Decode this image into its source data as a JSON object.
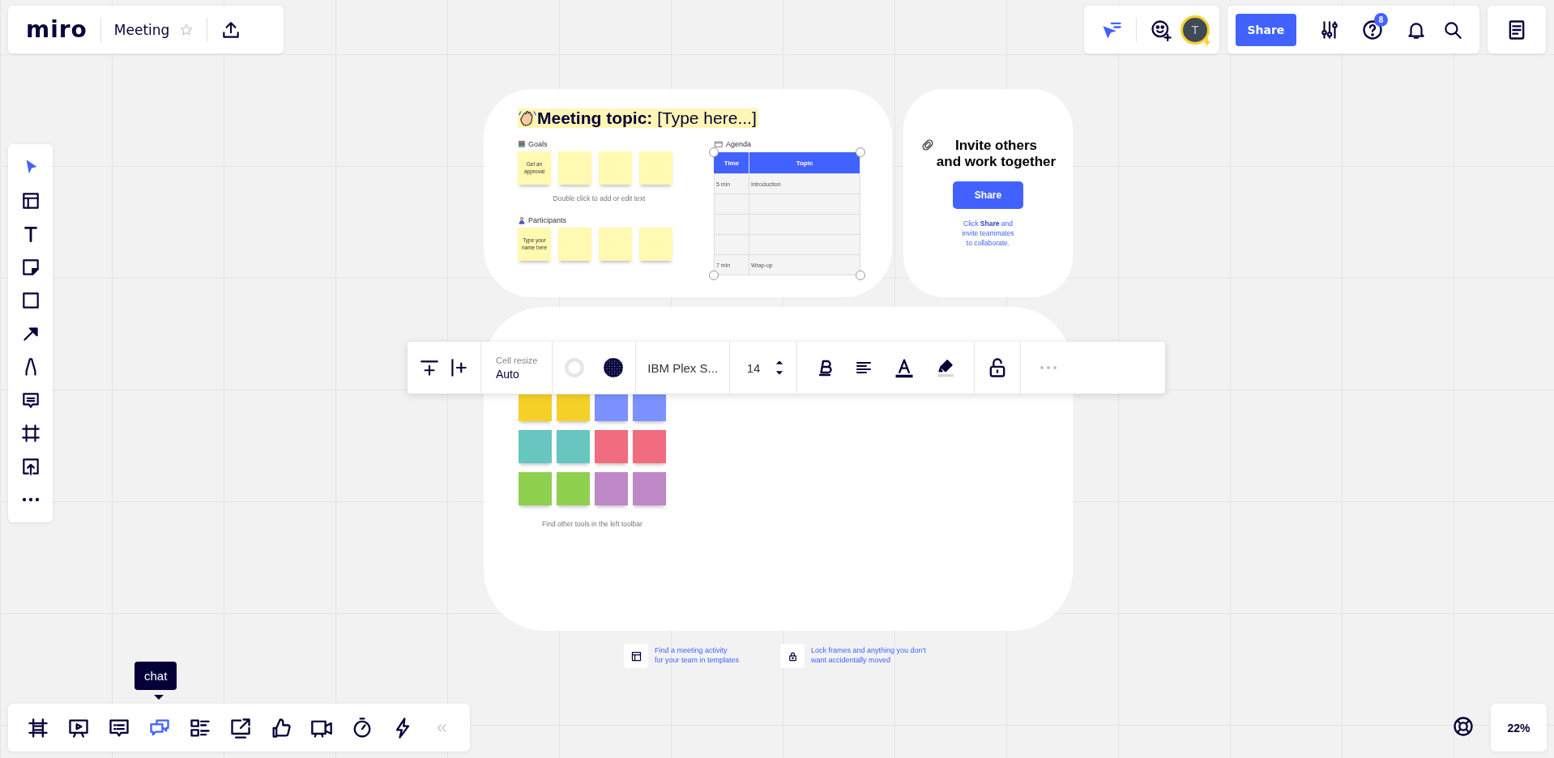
{
  "top_bar": {
    "logo": "miro",
    "board_title": "Meeting",
    "starred": false
  },
  "collab_bar": {
    "avatar_initial": "T"
  },
  "actions_bar": {
    "share_label": "Share",
    "help_badge": "8"
  },
  "left_toolbar": {
    "tools": [
      {
        "selected": true
      },
      {
        "selected": false
      },
      {
        "selected": false
      },
      {
        "selected": false
      },
      {
        "selected": false
      },
      {
        "selected": false
      },
      {
        "selected": false
      },
      {
        "selected": false
      },
      {
        "selected": false
      },
      {
        "selected": false
      },
      {
        "selected": false
      }
    ]
  },
  "meeting_frame": {
    "title": "**Meeting topic:** [Type here...]",
    "goals": {
      "label": "Goals",
      "notes": [
        {
          "kind": "text",
          "text": "Get an approval"
        },
        {
          "kind": "blank"
        },
        {
          "kind": "blank"
        },
        {
          "kind": "blank"
        }
      ]
    },
    "hint": "Double click to add or edit text",
    "participants": {
      "label": "Participants",
      "notes": [
        {
          "kind": "text",
          "text": "Type your name here"
        },
        {
          "kind": "blank"
        },
        {
          "kind": "blank"
        },
        {
          "kind": "blank"
        }
      ]
    },
    "agenda": {
      "label": "Agenda",
      "selected": true,
      "columns": [
        "Time",
        "Topic"
      ],
      "rows": [
        {
          "kind": "filled",
          "time": "5 min",
          "topic": "Introduction"
        },
        {
          "kind": "empty"
        },
        {
          "kind": "empty"
        },
        {
          "kind": "empty"
        },
        {
          "kind": "filled",
          "time": "7 min",
          "topic": "Wrap-up"
        }
      ]
    }
  },
  "invite_frame": {
    "title": "Invite others\nand work together",
    "button": "Share",
    "body": "Click **Share** and\ninvite teammates\nto collaborate."
  },
  "work_frame": {
    "notes": [
      {
        "color": "#f5d128"
      },
      {
        "color": "#f5d128"
      },
      {
        "color": "#7b92ff"
      },
      {
        "color": "#7b92ff"
      },
      {
        "color": "#67c6c0"
      },
      {
        "color": "#67c6c0"
      },
      {
        "color": "#f16c7f"
      },
      {
        "color": "#f16c7f"
      },
      {
        "color": "#8fd14f"
      },
      {
        "color": "#8fd14f"
      },
      {
        "color": "#be88c7"
      },
      {
        "color": "#be88c7"
      }
    ],
    "hint": "Find other tools in the left toolbar"
  },
  "table_toolbar": {
    "cell_resize_label": "Cell resize",
    "cell_resize_value": "Auto",
    "font": "IBM Plex S...",
    "font_size": "14"
  },
  "tips": [
    {
      "text": "Find a meeting activity\nfor your team in templates"
    },
    {
      "text": "Lock frames and anything you don't\nwant accidentally moved"
    }
  ],
  "bottom_toolbar": {
    "tools": [
      {
        "selected": false
      },
      {
        "selected": false
      },
      {
        "selected": false
      },
      {
        "selected": true
      },
      {
        "selected": false
      },
      {
        "selected": false
      },
      {
        "selected": false
      },
      {
        "selected": false
      },
      {
        "selected": false
      },
      {
        "selected": false
      }
    ],
    "tooltip": "chat"
  },
  "zoom": "22%"
}
